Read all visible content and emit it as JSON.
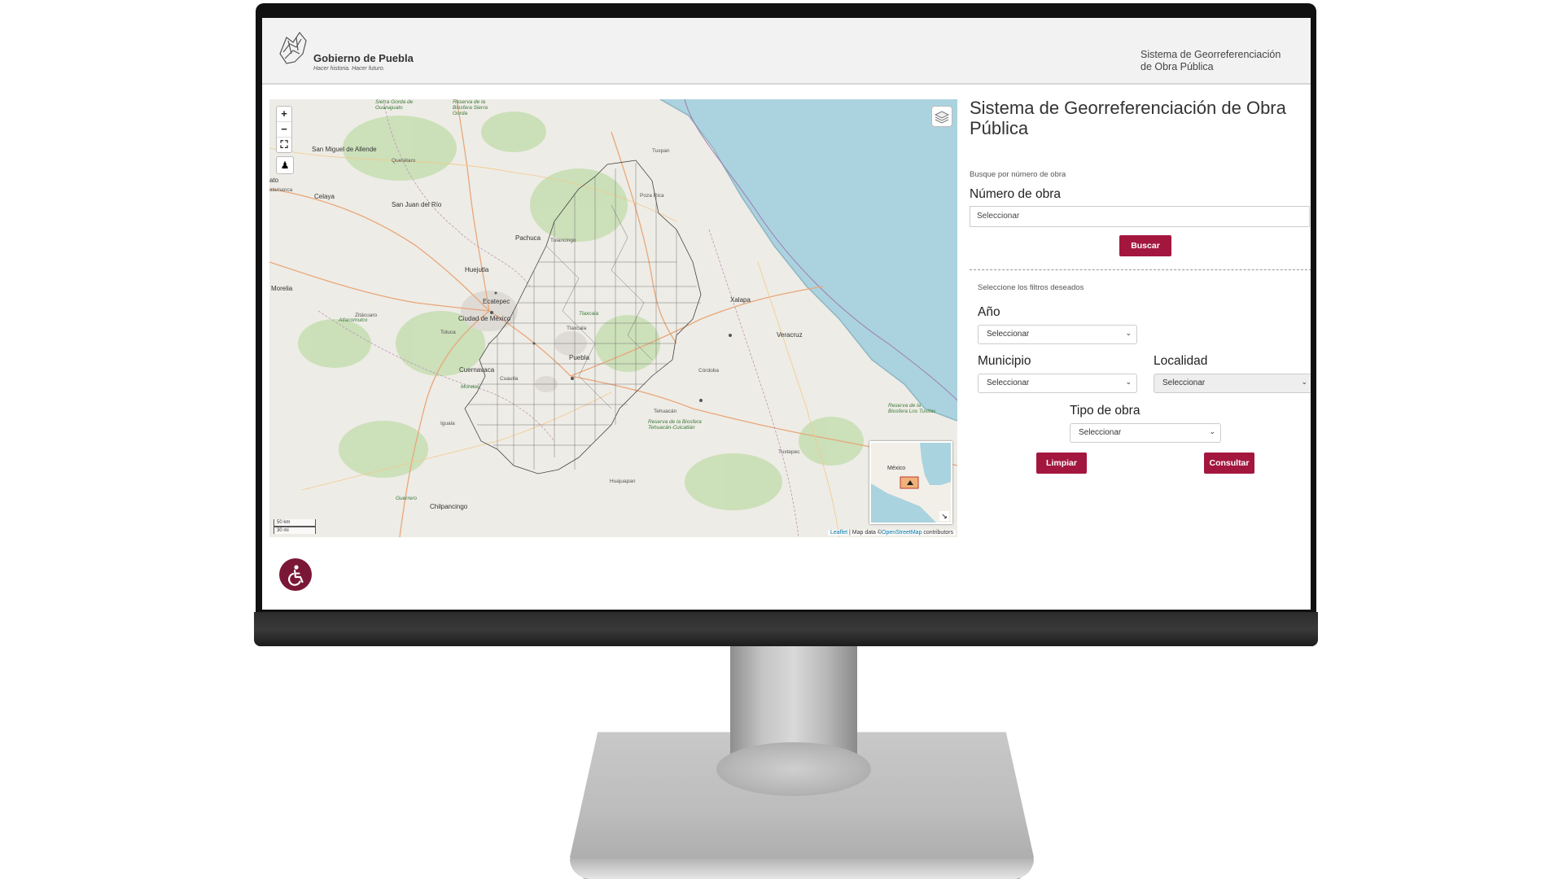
{
  "header": {
    "org_name": "Gobierno de Puebla",
    "tagline": "Hacer historia. Hacer futuro.",
    "system_name_line1": "Sistema de Georreferenciación",
    "system_name_line2": "de Obra Pública"
  },
  "map": {
    "zoom_in": "+",
    "zoom_out": "−",
    "fullscreen": "⛶",
    "labels": [
      "San Miguel de Allende",
      "Querétaro",
      "Celaya",
      "San Juan del Río",
      "Pachuca",
      "Tulancingo",
      "Huejutla",
      "Tuxpan",
      "Poza Rica",
      "Ecatepec",
      "Ciudad de México",
      "Morelia",
      "Zitácuaro",
      "Toluca",
      "Tlaxcala",
      "Puebla",
      "Xalapa",
      "Veracruz",
      "Cuernavaca",
      "Cuautla",
      "Córdoba",
      "Iguala",
      "Tehuacán",
      "Tuxtepec",
      "Huajuapan",
      "Chilpancingo",
      "Guerrero",
      "Atlacomulco",
      "Morelos",
      "Tlaxcala",
      "Sierra Gorda de Guanajuato",
      "Reserva de la Biosfera Sierra Gorda",
      "Reserva de la Biosfera Tehuacán-Cuicatlán",
      "Reserva de la Biosfera Los Tuxtlas",
      "ato",
      "alamanca"
    ],
    "minimap_label": "México",
    "scale_km": "50 km",
    "scale_mi": "30 mi",
    "attribution_leaflet": "Leaflet",
    "attribution_sep": " | Map data ©",
    "attribution_osm": "OpenStreetMap",
    "attribution_rest": " contributors"
  },
  "panel": {
    "title": "Sistema de Georreferenciación de Obra Pública",
    "search_hint": "Busque por número de obra",
    "numero_label": "Número de obra",
    "numero_placeholder": "Seleccionar",
    "buscar_label": "Buscar",
    "filters_hint": "Seleccione los filtros deseados",
    "anio_label": "Año",
    "anio_value": "Seleccionar",
    "municipio_label": "Municipio",
    "municipio_value": "Seleccionar",
    "localidad_label": "Localidad",
    "localidad_value": "Seleccionar",
    "tipo_label": "Tipo de obra",
    "tipo_value": "Seleccionar",
    "limpiar_label": "Limpiar",
    "consultar_label": "Consultar"
  },
  "colors": {
    "brand": "#a3173f",
    "fab": "#7a1737",
    "sea": "#aad3df"
  }
}
